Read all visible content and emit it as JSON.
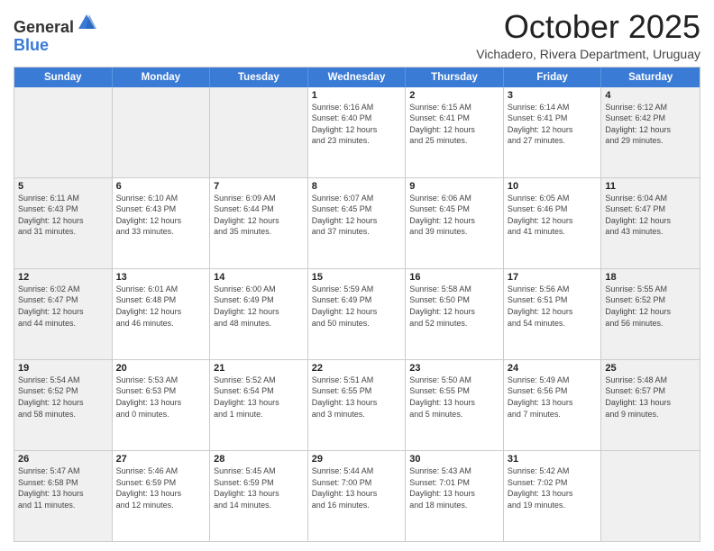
{
  "logo": {
    "general": "General",
    "blue": "Blue"
  },
  "header": {
    "month": "October 2025",
    "location": "Vichadero, Rivera Department, Uruguay"
  },
  "weekdays": [
    "Sunday",
    "Monday",
    "Tuesday",
    "Wednesday",
    "Thursday",
    "Friday",
    "Saturday"
  ],
  "rows": [
    [
      {
        "day": "",
        "text": "",
        "shaded": true
      },
      {
        "day": "",
        "text": "",
        "shaded": true
      },
      {
        "day": "",
        "text": "",
        "shaded": true
      },
      {
        "day": "1",
        "text": "Sunrise: 6:16 AM\nSunset: 6:40 PM\nDaylight: 12 hours\nand 23 minutes."
      },
      {
        "day": "2",
        "text": "Sunrise: 6:15 AM\nSunset: 6:41 PM\nDaylight: 12 hours\nand 25 minutes."
      },
      {
        "day": "3",
        "text": "Sunrise: 6:14 AM\nSunset: 6:41 PM\nDaylight: 12 hours\nand 27 minutes."
      },
      {
        "day": "4",
        "text": "Sunrise: 6:12 AM\nSunset: 6:42 PM\nDaylight: 12 hours\nand 29 minutes.",
        "shaded": true
      }
    ],
    [
      {
        "day": "5",
        "text": "Sunrise: 6:11 AM\nSunset: 6:43 PM\nDaylight: 12 hours\nand 31 minutes.",
        "shaded": true
      },
      {
        "day": "6",
        "text": "Sunrise: 6:10 AM\nSunset: 6:43 PM\nDaylight: 12 hours\nand 33 minutes."
      },
      {
        "day": "7",
        "text": "Sunrise: 6:09 AM\nSunset: 6:44 PM\nDaylight: 12 hours\nand 35 minutes."
      },
      {
        "day": "8",
        "text": "Sunrise: 6:07 AM\nSunset: 6:45 PM\nDaylight: 12 hours\nand 37 minutes."
      },
      {
        "day": "9",
        "text": "Sunrise: 6:06 AM\nSunset: 6:45 PM\nDaylight: 12 hours\nand 39 minutes."
      },
      {
        "day": "10",
        "text": "Sunrise: 6:05 AM\nSunset: 6:46 PM\nDaylight: 12 hours\nand 41 minutes."
      },
      {
        "day": "11",
        "text": "Sunrise: 6:04 AM\nSunset: 6:47 PM\nDaylight: 12 hours\nand 43 minutes.",
        "shaded": true
      }
    ],
    [
      {
        "day": "12",
        "text": "Sunrise: 6:02 AM\nSunset: 6:47 PM\nDaylight: 12 hours\nand 44 minutes.",
        "shaded": true
      },
      {
        "day": "13",
        "text": "Sunrise: 6:01 AM\nSunset: 6:48 PM\nDaylight: 12 hours\nand 46 minutes."
      },
      {
        "day": "14",
        "text": "Sunrise: 6:00 AM\nSunset: 6:49 PM\nDaylight: 12 hours\nand 48 minutes."
      },
      {
        "day": "15",
        "text": "Sunrise: 5:59 AM\nSunset: 6:49 PM\nDaylight: 12 hours\nand 50 minutes."
      },
      {
        "day": "16",
        "text": "Sunrise: 5:58 AM\nSunset: 6:50 PM\nDaylight: 12 hours\nand 52 minutes."
      },
      {
        "day": "17",
        "text": "Sunrise: 5:56 AM\nSunset: 6:51 PM\nDaylight: 12 hours\nand 54 minutes."
      },
      {
        "day": "18",
        "text": "Sunrise: 5:55 AM\nSunset: 6:52 PM\nDaylight: 12 hours\nand 56 minutes.",
        "shaded": true
      }
    ],
    [
      {
        "day": "19",
        "text": "Sunrise: 5:54 AM\nSunset: 6:52 PM\nDaylight: 12 hours\nand 58 minutes.",
        "shaded": true
      },
      {
        "day": "20",
        "text": "Sunrise: 5:53 AM\nSunset: 6:53 PM\nDaylight: 13 hours\nand 0 minutes."
      },
      {
        "day": "21",
        "text": "Sunrise: 5:52 AM\nSunset: 6:54 PM\nDaylight: 13 hours\nand 1 minute."
      },
      {
        "day": "22",
        "text": "Sunrise: 5:51 AM\nSunset: 6:55 PM\nDaylight: 13 hours\nand 3 minutes."
      },
      {
        "day": "23",
        "text": "Sunrise: 5:50 AM\nSunset: 6:55 PM\nDaylight: 13 hours\nand 5 minutes."
      },
      {
        "day": "24",
        "text": "Sunrise: 5:49 AM\nSunset: 6:56 PM\nDaylight: 13 hours\nand 7 minutes."
      },
      {
        "day": "25",
        "text": "Sunrise: 5:48 AM\nSunset: 6:57 PM\nDaylight: 13 hours\nand 9 minutes.",
        "shaded": true
      }
    ],
    [
      {
        "day": "26",
        "text": "Sunrise: 5:47 AM\nSunset: 6:58 PM\nDaylight: 13 hours\nand 11 minutes.",
        "shaded": true
      },
      {
        "day": "27",
        "text": "Sunrise: 5:46 AM\nSunset: 6:59 PM\nDaylight: 13 hours\nand 12 minutes."
      },
      {
        "day": "28",
        "text": "Sunrise: 5:45 AM\nSunset: 6:59 PM\nDaylight: 13 hours\nand 14 minutes."
      },
      {
        "day": "29",
        "text": "Sunrise: 5:44 AM\nSunset: 7:00 PM\nDaylight: 13 hours\nand 16 minutes."
      },
      {
        "day": "30",
        "text": "Sunrise: 5:43 AM\nSunset: 7:01 PM\nDaylight: 13 hours\nand 18 minutes."
      },
      {
        "day": "31",
        "text": "Sunrise: 5:42 AM\nSunset: 7:02 PM\nDaylight: 13 hours\nand 19 minutes."
      },
      {
        "day": "",
        "text": "",
        "shaded": true
      }
    ]
  ]
}
